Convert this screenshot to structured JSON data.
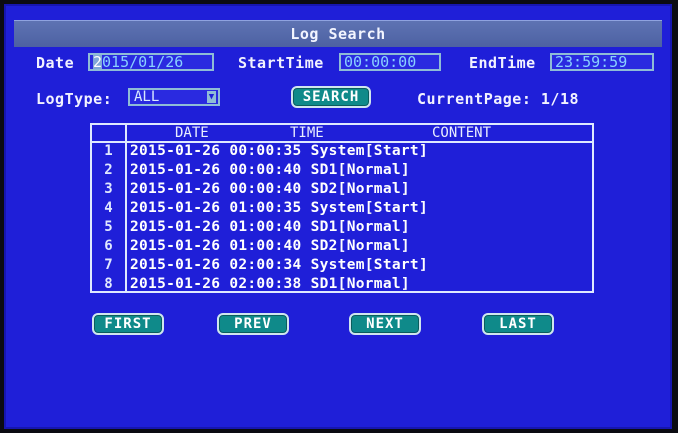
{
  "window": {
    "title": "Log Search"
  },
  "filters": {
    "date_label": "Date",
    "date_value_highlight": "2",
    "date_value_rest": "015/01/26",
    "start_label": "StartTime",
    "start_value": "00:00:00",
    "end_label": "EndTime",
    "end_value": "23:59:59",
    "logtype_label": "LogType:",
    "logtype_value": "ALL",
    "search_label": "SEARCH",
    "current_page_label": "CurrentPage: 1/18"
  },
  "table": {
    "columns": [
      "DATE",
      "TIME",
      "CONTENT"
    ],
    "rows": [
      {
        "num": "1",
        "text": "2015-01-26 00:00:35 System[Start]"
      },
      {
        "num": "2",
        "text": "2015-01-26 00:00:40 SD1[Normal]"
      },
      {
        "num": "3",
        "text": "2015-01-26 00:00:40 SD2[Normal]"
      },
      {
        "num": "4",
        "text": "2015-01-26 01:00:35 System[Start]"
      },
      {
        "num": "5",
        "text": "2015-01-26 01:00:40 SD1[Normal]"
      },
      {
        "num": "6",
        "text": "2015-01-26 01:00:40 SD2[Normal]"
      },
      {
        "num": "7",
        "text": "2015-01-26 02:00:34 System[Start]"
      },
      {
        "num": "8",
        "text": "2015-01-26 02:00:38 SD1[Normal]"
      }
    ]
  },
  "pager": {
    "first_label": "FIRST",
    "prev_label": "PREV",
    "next_label": "NEXT",
    "last_label": "LAST"
  },
  "colors": {
    "background": "#1f1fd8",
    "titlebar": "#5568a8",
    "button": "#0f8a8a",
    "field_text": "#8ad0ff"
  },
  "icons": {
    "dropdown": "chevron-down-icon"
  }
}
